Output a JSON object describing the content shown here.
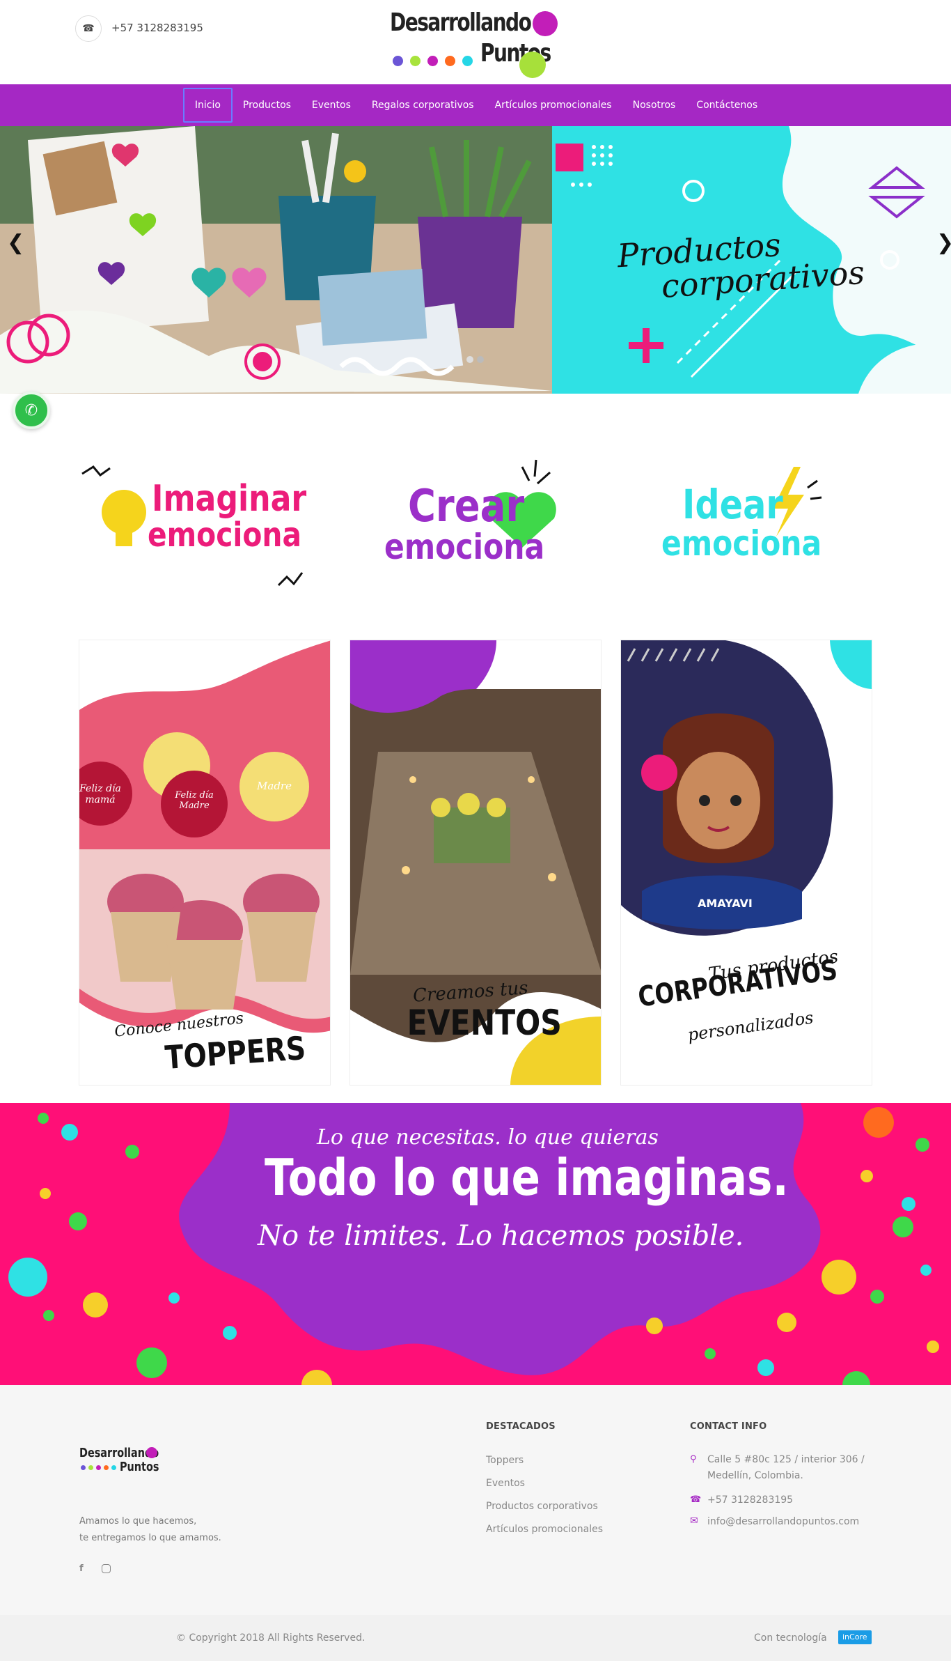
{
  "header": {
    "phone": "+57 3128283195",
    "logo_line1": "Desarrollando",
    "logo_line2": "Puntos"
  },
  "nav": {
    "items": [
      "Inicio",
      "Productos",
      "Eventos",
      "Regalos corporativos",
      "Artículos promocionales",
      "Nosotros",
      "Contáctenos"
    ]
  },
  "slider": {
    "title_line1": "Productos",
    "title_line2": "corporativos"
  },
  "emotions": [
    {
      "word": "Imaginar",
      "sub": "emociona"
    },
    {
      "word": "Crear",
      "sub": "emociona"
    },
    {
      "word": "Idear",
      "sub": "emociona"
    }
  ],
  "cards": [
    {
      "small": "Conoce nuestros",
      "big": "TOPPERS",
      "topper1": "Feliz día mamá",
      "topper2": "Feliz día Madre",
      "topper3": "Madre"
    },
    {
      "small": "Creamos tus",
      "big": "EVENTOS"
    },
    {
      "small": "Tus productos",
      "big": "CORPORATIVOS",
      "small2": "personalizados",
      "notebook_text": "AMAYAVI"
    }
  ],
  "banner": {
    "line1": "Lo que necesitas. lo que quieras",
    "line2": "Todo lo que imaginas.",
    "line3": "No te limites. Lo hacemos posible."
  },
  "footer": {
    "logo_line1": "Desarrollando",
    "logo_line2": "Puntos",
    "tagline1": "Amamos lo que hacemos,",
    "tagline2": "te entregamos lo que amamos.",
    "destacados_title": "DESTACADOS",
    "destacados": [
      "Toppers",
      "Eventos",
      "Productos corporativos",
      "Artículos promocionales"
    ],
    "contact_title": "CONTACT INFO",
    "address1": "Calle 5 #80c 125 / interior 306 /",
    "address2": "Medellín, Colombia.",
    "phone": "+57 3128283195",
    "email": "info@desarrollandopuntos.com",
    "copyright": "© Copyright 2018 All Rights Reserved.",
    "powered": "Con tecnología",
    "powered_badge": "inCore"
  },
  "icons": {
    "phone": "phone-icon",
    "facebook": "facebook-icon",
    "instagram": "instagram-icon",
    "whatsapp": "whatsapp-icon",
    "map_pin": "map-pin-icon",
    "mail": "mail-icon"
  },
  "colors": {
    "nav_bg": "#a528c4",
    "pink": "#ff0f77",
    "purple": "#9b2fc9",
    "cyan": "#2fe1e4",
    "green": "#3fd84a",
    "yellow": "#f6cf2a"
  }
}
